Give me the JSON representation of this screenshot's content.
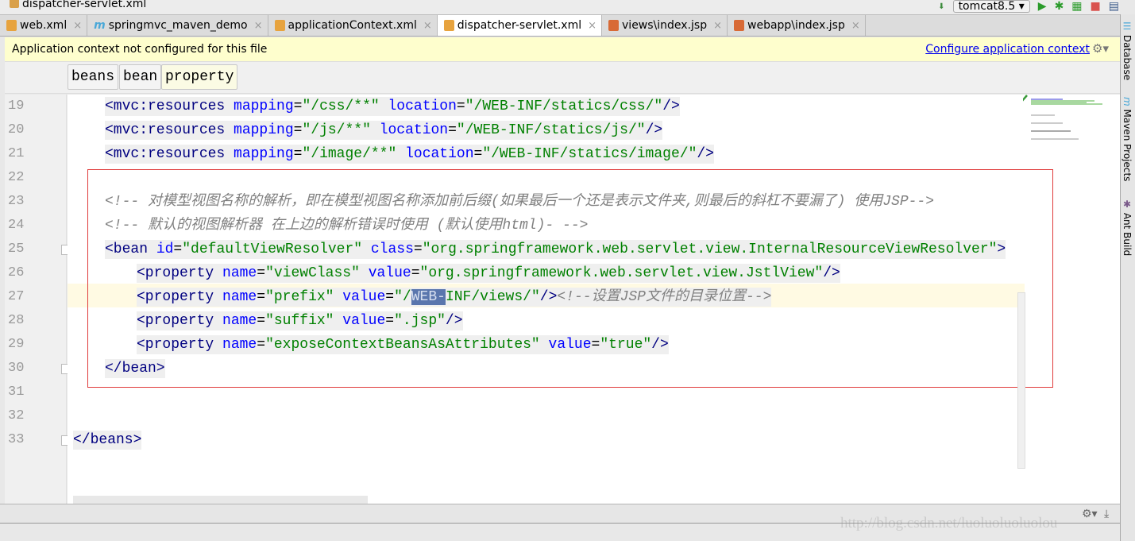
{
  "navbar": {
    "crumb": "dispatcher-servlet.xml",
    "run_config": "tomcat8.5"
  },
  "tabs": [
    {
      "label": "web.xml",
      "icon": "xml-file-icon",
      "active": false
    },
    {
      "label": "springmvc_maven_demo",
      "icon": "maven-icon",
      "active": false
    },
    {
      "label": "applicationContext.xml",
      "icon": "spring-xml-icon",
      "active": false
    },
    {
      "label": "dispatcher-servlet.xml",
      "icon": "spring-xml-icon",
      "active": true
    },
    {
      "label": "views\\index.jsp",
      "icon": "jsp-file-icon",
      "active": false
    },
    {
      "label": "webapp\\index.jsp",
      "icon": "jsp-file-icon",
      "active": false
    }
  ],
  "banner": {
    "message": "Application context not configured for this file",
    "link": "Configure application context"
  },
  "breadcrumbs": [
    "beans",
    "bean",
    "property"
  ],
  "right_panels": [
    "Database",
    "Maven Projects",
    "Ant Build"
  ],
  "watermark": "http://blog.csdn.net/luoluoluoluolou",
  "colors": {
    "tag": "#000080",
    "attribute": "#0000ff",
    "value": "#008000",
    "comment": "#808080",
    "highlight_box": "#e03c3c",
    "banner": "#fefecd"
  },
  "code": [
    {
      "n": "19",
      "indent": 4,
      "tokens": [
        [
          "t",
          "<mvc:resources "
        ],
        [
          "a",
          "mapping"
        ],
        [
          "p",
          "="
        ],
        [
          "v",
          "\"/css/**\" "
        ],
        [
          "a",
          "location"
        ],
        [
          "p",
          "="
        ],
        [
          "v",
          "\"/WEB-INF/statics/css/\""
        ],
        [
          "t",
          "/>"
        ]
      ]
    },
    {
      "n": "20",
      "indent": 4,
      "tokens": [
        [
          "t",
          "<mvc:resources "
        ],
        [
          "a",
          "mapping"
        ],
        [
          "p",
          "="
        ],
        [
          "v",
          "\"/js/**\" "
        ],
        [
          "a",
          "location"
        ],
        [
          "p",
          "="
        ],
        [
          "v",
          "\"/WEB-INF/statics/js/\""
        ],
        [
          "t",
          "/>"
        ]
      ]
    },
    {
      "n": "21",
      "indent": 4,
      "tokens": [
        [
          "t",
          "<mvc:resources "
        ],
        [
          "a",
          "mapping"
        ],
        [
          "p",
          "="
        ],
        [
          "v",
          "\"/image/**\" "
        ],
        [
          "a",
          "location"
        ],
        [
          "p",
          "="
        ],
        [
          "v",
          "\"/WEB-INF/statics/image/\""
        ],
        [
          "t",
          "/>"
        ]
      ]
    },
    {
      "n": "22",
      "indent": 0,
      "tokens": []
    },
    {
      "n": "23",
      "indent": 4,
      "nobg": true,
      "tokens": [
        [
          "c",
          "<!-- 对模型视图名称的解析，即在模型视图名称添加前后缀(如果最后一个还是表示文件夹,则最后的斜杠不要漏了) 使用JSP-->"
        ]
      ]
    },
    {
      "n": "24",
      "indent": 4,
      "nobg": true,
      "tokens": [
        [
          "c",
          "<!-- 默认的视图解析器 在上边的解析错误时使用 (默认使用html)- -->"
        ]
      ]
    },
    {
      "n": "25",
      "indent": 4,
      "tokens": [
        [
          "t",
          "<bean "
        ],
        [
          "a",
          "id"
        ],
        [
          "p",
          "="
        ],
        [
          "v",
          "\"defaultViewResolver\" "
        ],
        [
          "a",
          "class"
        ],
        [
          "p",
          "="
        ],
        [
          "v",
          "\"org.springframework.web.servlet.view.InternalResourceViewResolver\""
        ],
        [
          "t",
          ">"
        ]
      ]
    },
    {
      "n": "26",
      "indent": 8,
      "tokens": [
        [
          "t",
          "<property "
        ],
        [
          "a",
          "name"
        ],
        [
          "p",
          "="
        ],
        [
          "v",
          "\"viewClass\" "
        ],
        [
          "a",
          "value"
        ],
        [
          "p",
          "="
        ],
        [
          "v",
          "\"org.springframework.web.servlet.view.JstlView\""
        ],
        [
          "t",
          "/>"
        ]
      ]
    },
    {
      "n": "27",
      "indent": 8,
      "tokens": [
        [
          "t",
          "<property "
        ],
        [
          "a",
          "name"
        ],
        [
          "p",
          "="
        ],
        [
          "v",
          "\"prefix\" "
        ],
        [
          "a",
          "value"
        ],
        [
          "p",
          "="
        ],
        [
          "v",
          "\"/"
        ],
        [
          "sel",
          "WEB-"
        ],
        [
          "v",
          "INF/views/\""
        ],
        [
          "t",
          "/>"
        ],
        [
          "c",
          "<!--设置JSP文件的目录位置-->"
        ]
      ]
    },
    {
      "n": "28",
      "indent": 8,
      "tokens": [
        [
          "t",
          "<property "
        ],
        [
          "a",
          "name"
        ],
        [
          "p",
          "="
        ],
        [
          "v",
          "\"suffix\" "
        ],
        [
          "a",
          "value"
        ],
        [
          "p",
          "="
        ],
        [
          "v",
          "\".jsp\""
        ],
        [
          "t",
          "/>"
        ]
      ]
    },
    {
      "n": "29",
      "indent": 8,
      "tokens": [
        [
          "t",
          "<property "
        ],
        [
          "a",
          "name"
        ],
        [
          "p",
          "="
        ],
        [
          "v",
          "\"exposeContextBeansAsAttributes\" "
        ],
        [
          "a",
          "value"
        ],
        [
          "p",
          "="
        ],
        [
          "v",
          "\"true\""
        ],
        [
          "t",
          "/>"
        ]
      ]
    },
    {
      "n": "30",
      "indent": 4,
      "tokens": [
        [
          "t",
          "</bean>"
        ]
      ]
    },
    {
      "n": "31",
      "indent": 0,
      "tokens": []
    },
    {
      "n": "32",
      "indent": 0,
      "tokens": []
    },
    {
      "n": "33",
      "indent": 0,
      "tokens": [
        [
          "t",
          "</beans>"
        ]
      ]
    }
  ]
}
